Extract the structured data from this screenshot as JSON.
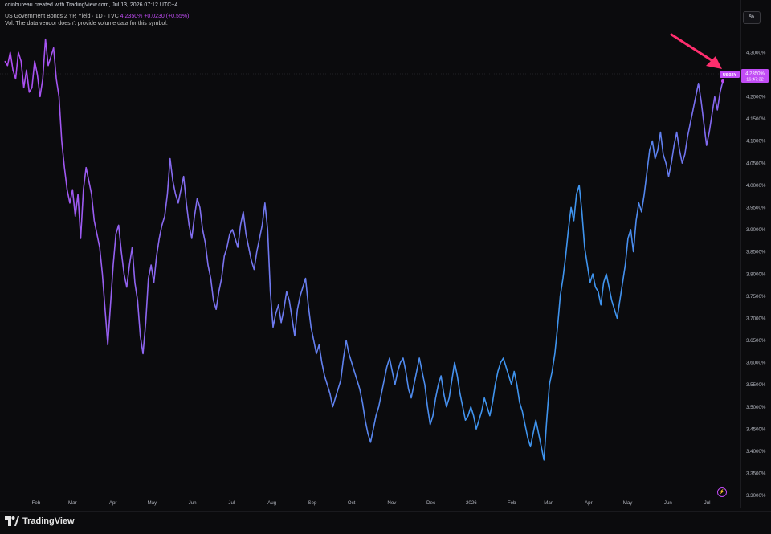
{
  "header": {
    "credit": "coinbureau created with TradingView.com, Jul 13, 2026 07:12 UTC+4",
    "symbol_title": "US Government Bonds 2 YR Yield · 1D · TVC",
    "last_value": "4.2350%",
    "change": "+0.0230 (+0.55%)",
    "volume_note": "Vol: The data vendor doesn't provide volume data for this symbol."
  },
  "toolbar": {
    "percent_button": "%"
  },
  "footer": {
    "brand": "TradingView"
  },
  "price_tag": {
    "symbol": "US02Y",
    "value": "4.2350%",
    "countdown": "16:47:32"
  },
  "colors": {
    "background": "#0b0b0d",
    "line_start": "#b14cf2",
    "line_mid": "#3f94ee",
    "line_end": "#b14cf2",
    "tag": "#c14cf5",
    "arrow": "#ff2e6e",
    "text": "#d1d4dc"
  },
  "chart_data": {
    "type": "line",
    "title": "US Government Bonds 2 YR Yield · 1D · TVC",
    "xlabel": "",
    "ylabel": "",
    "x_ticks": [
      "Feb",
      "Mar",
      "Apr",
      "May",
      "Jun",
      "Jul",
      "Aug",
      "Sep",
      "Oct",
      "Nov",
      "Dec",
      "2026",
      "Feb",
      "Mar",
      "Apr",
      "May",
      "Jun",
      "Jul"
    ],
    "y_ticks": [
      "4.3000%",
      "4.2500%",
      "4.2000%",
      "4.1500%",
      "4.1000%",
      "4.0500%",
      "4.0000%",
      "3.9500%",
      "3.9000%",
      "3.8500%",
      "3.8000%",
      "3.7500%",
      "3.7000%",
      "3.6500%",
      "3.6000%",
      "3.5500%",
      "3.5000%",
      "3.4500%",
      "3.4000%",
      "3.3500%",
      "3.3000%"
    ],
    "ylim": [
      3.3,
      4.3275
    ],
    "grid": false,
    "series": [
      {
        "name": "US02Y",
        "x_range": [
          "2025-01-08",
          "2026-07-13"
        ],
        "values": [
          4.28,
          4.27,
          4.3,
          4.26,
          4.24,
          4.3,
          4.28,
          4.22,
          4.26,
          4.21,
          4.22,
          4.28,
          4.25,
          4.2,
          4.24,
          4.33,
          4.27,
          4.29,
          4.31,
          4.24,
          4.2,
          4.1,
          4.04,
          3.99,
          3.96,
          3.99,
          3.93,
          3.98,
          3.88,
          3.99,
          4.04,
          4.01,
          3.98,
          3.92,
          3.89,
          3.86,
          3.8,
          3.72,
          3.64,
          3.73,
          3.82,
          3.89,
          3.91,
          3.85,
          3.8,
          3.77,
          3.82,
          3.86,
          3.78,
          3.74,
          3.66,
          3.62,
          3.69,
          3.79,
          3.82,
          3.78,
          3.84,
          3.88,
          3.91,
          3.93,
          3.98,
          4.06,
          4.01,
          3.98,
          3.96,
          3.99,
          4.02,
          3.96,
          3.91,
          3.88,
          3.93,
          3.97,
          3.95,
          3.9,
          3.87,
          3.82,
          3.79,
          3.74,
          3.72,
          3.76,
          3.79,
          3.84,
          3.86,
          3.89,
          3.9,
          3.88,
          3.86,
          3.91,
          3.94,
          3.89,
          3.86,
          3.83,
          3.81,
          3.85,
          3.88,
          3.91,
          3.96,
          3.9,
          3.76,
          3.68,
          3.71,
          3.73,
          3.69,
          3.72,
          3.76,
          3.74,
          3.7,
          3.66,
          3.72,
          3.75,
          3.77,
          3.79,
          3.73,
          3.68,
          3.65,
          3.62,
          3.64,
          3.6,
          3.57,
          3.55,
          3.53,
          3.5,
          3.52,
          3.54,
          3.56,
          3.61,
          3.65,
          3.62,
          3.6,
          3.58,
          3.56,
          3.54,
          3.51,
          3.47,
          3.44,
          3.42,
          3.45,
          3.48,
          3.5,
          3.53,
          3.56,
          3.59,
          3.61,
          3.58,
          3.55,
          3.58,
          3.6,
          3.61,
          3.58,
          3.54,
          3.52,
          3.55,
          3.58,
          3.61,
          3.58,
          3.55,
          3.5,
          3.46,
          3.48,
          3.52,
          3.55,
          3.57,
          3.53,
          3.5,
          3.52,
          3.56,
          3.6,
          3.57,
          3.53,
          3.5,
          3.47,
          3.48,
          3.5,
          3.48,
          3.45,
          3.47,
          3.49,
          3.52,
          3.5,
          3.48,
          3.51,
          3.55,
          3.58,
          3.6,
          3.61,
          3.59,
          3.57,
          3.55,
          3.58,
          3.55,
          3.51,
          3.49,
          3.46,
          3.43,
          3.41,
          3.44,
          3.47,
          3.44,
          3.41,
          3.38,
          3.47,
          3.55,
          3.58,
          3.62,
          3.68,
          3.75,
          3.79,
          3.84,
          3.9,
          3.95,
          3.92,
          3.98,
          4.0,
          3.94,
          3.86,
          3.82,
          3.78,
          3.8,
          3.77,
          3.76,
          3.73,
          3.78,
          3.8,
          3.77,
          3.74,
          3.72,
          3.7,
          3.74,
          3.78,
          3.82,
          3.88,
          3.9,
          3.85,
          3.92,
          3.96,
          3.94,
          3.98,
          4.03,
          4.08,
          4.1,
          4.06,
          4.08,
          4.12,
          4.07,
          4.05,
          4.02,
          4.05,
          4.09,
          4.12,
          4.08,
          4.05,
          4.07,
          4.11,
          4.14,
          4.17,
          4.2,
          4.23,
          4.19,
          4.14,
          4.09,
          4.12,
          4.16,
          4.2,
          4.17,
          4.21,
          4.235
        ]
      }
    ]
  }
}
